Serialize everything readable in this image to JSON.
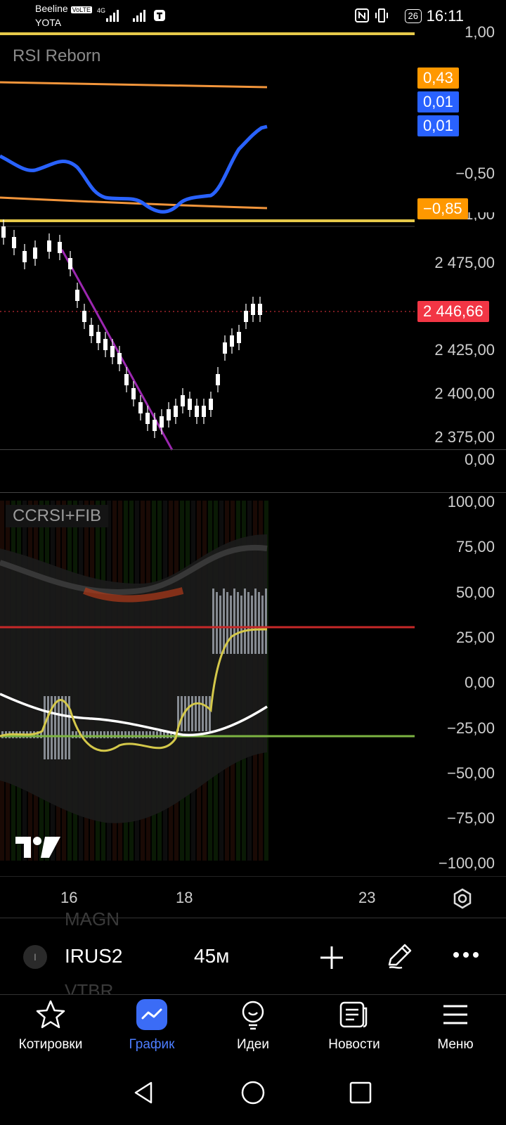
{
  "status_bar": {
    "carrier1": "Beeline",
    "carrier2": "YOTA",
    "volte": "VoLTE",
    "net": "4G",
    "battery": "26",
    "time": "16:11"
  },
  "rsi_pane": {
    "title": "RSI Reborn",
    "scale_top": "1,00",
    "scale_mid": "−0,50",
    "scale_bottom": "−1,00",
    "tags": [
      {
        "label": "0,43",
        "color": "#ff9800"
      },
      {
        "label": "0,01",
        "color": "#2962ff"
      },
      {
        "label": "0,01",
        "color": "#2962ff"
      },
      {
        "label": "−0,85",
        "color": "#ff9800"
      }
    ]
  },
  "price_pane": {
    "scale": [
      "2 475,00",
      "2 425,00",
      "2 400,00",
      "2 375,00"
    ],
    "last_price": "2 446,66",
    "last_price_color": "#f23645",
    "zero_label": "0,00"
  },
  "ccrsi_pane": {
    "title": "CCRSI+FIB",
    "scale": [
      "100,00",
      "75,00",
      "50,00",
      "25,00",
      "0,00",
      "−25,00",
      "−50,00",
      "−75,00",
      "−100,00"
    ]
  },
  "x_axis": {
    "ticks": [
      "16",
      "18",
      "23"
    ]
  },
  "toolbar": {
    "symbol_badge": "I",
    "symbol": "IRUS2",
    "interval": "45м",
    "ghost_above": "MAGN",
    "ghost_below": "VTBR"
  },
  "bottom_nav": {
    "items": [
      {
        "label": "Котировки",
        "icon": "star-icon"
      },
      {
        "label": "График",
        "icon": "chart-icon"
      },
      {
        "label": "Идеи",
        "icon": "lightbulb-icon"
      },
      {
        "label": "Новости",
        "icon": "news-icon"
      },
      {
        "label": "Меню",
        "icon": "menu-icon"
      }
    ],
    "active_color": "#4c7dff"
  }
}
